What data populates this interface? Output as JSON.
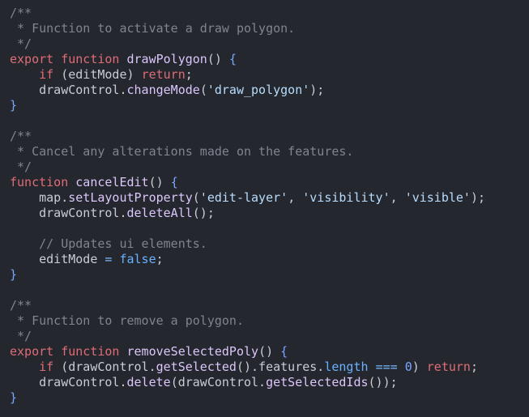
{
  "editor": {
    "lines": [
      [
        {
          "t": "/**",
          "c": "comment"
        }
      ],
      [
        {
          "t": " * Function to activate a draw polygon.",
          "c": "comment"
        }
      ],
      [
        {
          "t": " */",
          "c": "comment"
        }
      ],
      [
        {
          "t": "export",
          "c": "keyword"
        },
        {
          "t": " ",
          "c": "plain"
        },
        {
          "t": "function",
          "c": "keyword"
        },
        {
          "t": " ",
          "c": "plain"
        },
        {
          "t": "drawPolygon",
          "c": "function"
        },
        {
          "t": "()",
          "c": "plain"
        },
        {
          "t": " ",
          "c": "plain"
        },
        {
          "t": "{",
          "c": "brace"
        }
      ],
      [
        {
          "t": "    ",
          "c": "plain"
        },
        {
          "t": "if",
          "c": "keyword"
        },
        {
          "t": " (editMode) ",
          "c": "plain"
        },
        {
          "t": "return",
          "c": "keyword"
        },
        {
          "t": ";",
          "c": "plain"
        }
      ],
      [
        {
          "t": "    drawControl.",
          "c": "plain"
        },
        {
          "t": "changeMode",
          "c": "function"
        },
        {
          "t": "(",
          "c": "plain"
        },
        {
          "t": "'draw_polygon'",
          "c": "string"
        },
        {
          "t": ");",
          "c": "plain"
        }
      ],
      [
        {
          "t": "}",
          "c": "brace"
        }
      ],
      [],
      [
        {
          "t": "/**",
          "c": "comment"
        }
      ],
      [
        {
          "t": " * Cancel any alterations made on the features.",
          "c": "comment"
        }
      ],
      [
        {
          "t": " */",
          "c": "comment"
        }
      ],
      [
        {
          "t": "function",
          "c": "keyword"
        },
        {
          "t": " ",
          "c": "plain"
        },
        {
          "t": "cancelEdit",
          "c": "function"
        },
        {
          "t": "()",
          "c": "plain"
        },
        {
          "t": " ",
          "c": "plain"
        },
        {
          "t": "{",
          "c": "brace"
        }
      ],
      [
        {
          "t": "    map.",
          "c": "plain"
        },
        {
          "t": "setLayoutProperty",
          "c": "function"
        },
        {
          "t": "(",
          "c": "plain"
        },
        {
          "t": "'edit-layer'",
          "c": "string"
        },
        {
          "t": ", ",
          "c": "plain"
        },
        {
          "t": "'visibility'",
          "c": "string"
        },
        {
          "t": ", ",
          "c": "plain"
        },
        {
          "t": "'visible'",
          "c": "string"
        },
        {
          "t": ");",
          "c": "plain"
        }
      ],
      [
        {
          "t": "    drawControl.",
          "c": "plain"
        },
        {
          "t": "deleteAll",
          "c": "function"
        },
        {
          "t": "();",
          "c": "plain"
        }
      ],
      [],
      [
        {
          "t": "    ",
          "c": "plain"
        },
        {
          "t": "// Updates ui elements.",
          "c": "comment"
        }
      ],
      [
        {
          "t": "    editMode ",
          "c": "plain"
        },
        {
          "t": "=",
          "c": "operator"
        },
        {
          "t": " ",
          "c": "plain"
        },
        {
          "t": "false",
          "c": "bool"
        },
        {
          "t": ";",
          "c": "plain"
        }
      ],
      [
        {
          "t": "}",
          "c": "brace"
        }
      ],
      [],
      [
        {
          "t": "/**",
          "c": "comment"
        }
      ],
      [
        {
          "t": " * Function to remove a polygon.",
          "c": "comment"
        }
      ],
      [
        {
          "t": " */",
          "c": "comment"
        }
      ],
      [
        {
          "t": "export",
          "c": "keyword"
        },
        {
          "t": " ",
          "c": "plain"
        },
        {
          "t": "function",
          "c": "keyword"
        },
        {
          "t": " ",
          "c": "plain"
        },
        {
          "t": "removeSelectedPoly",
          "c": "function"
        },
        {
          "t": "()",
          "c": "plain"
        },
        {
          "t": " ",
          "c": "plain"
        },
        {
          "t": "{",
          "c": "brace"
        }
      ],
      [
        {
          "t": "    ",
          "c": "plain"
        },
        {
          "t": "if",
          "c": "keyword"
        },
        {
          "t": " (drawControl.",
          "c": "plain"
        },
        {
          "t": "getSelected",
          "c": "function"
        },
        {
          "t": "().features.",
          "c": "plain"
        },
        {
          "t": "length",
          "c": "property"
        },
        {
          "t": " ",
          "c": "plain"
        },
        {
          "t": "===",
          "c": "operator"
        },
        {
          "t": " ",
          "c": "plain"
        },
        {
          "t": "0",
          "c": "number"
        },
        {
          "t": ") ",
          "c": "plain"
        },
        {
          "t": "return",
          "c": "keyword"
        },
        {
          "t": ";",
          "c": "plain"
        }
      ],
      [
        {
          "t": "    drawControl.",
          "c": "plain"
        },
        {
          "t": "delete",
          "c": "function"
        },
        {
          "t": "(drawControl.",
          "c": "plain"
        },
        {
          "t": "getSelectedIds",
          "c": "function"
        },
        {
          "t": "());",
          "c": "plain"
        }
      ],
      [
        {
          "t": "}",
          "c": "brace"
        }
      ]
    ]
  }
}
